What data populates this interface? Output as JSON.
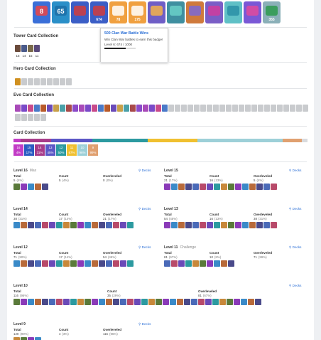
{
  "badges": [
    {
      "id": "b1",
      "top": "8",
      "bottom": "",
      "color": "#3a6fd8",
      "accent": "#e44"
    },
    {
      "id": "b2",
      "top": "65",
      "bottom": "",
      "color": "#2a8fc8",
      "accent": "#1c6fa6"
    },
    {
      "id": "b3",
      "top": "",
      "bottom": "",
      "color": "#3b5ec6",
      "accent": "#d23c3c"
    },
    {
      "id": "b4",
      "top": "",
      "bottom": "674",
      "color": "#3b5ec6",
      "accent": "#d23c3c"
    },
    {
      "id": "b5",
      "top": "",
      "bottom": "78",
      "color": "#f0a040",
      "accent": "#ffffff"
    },
    {
      "id": "b6",
      "top": "",
      "bottom": "175",
      "color": "#f0a040",
      "accent": "#ffffff"
    },
    {
      "id": "b7",
      "top": "",
      "bottom": "",
      "color": "#6f5ec6",
      "accent": "#f3b24a"
    },
    {
      "id": "b8",
      "top": "",
      "bottom": "",
      "color": "#3f8fa0",
      "accent": "#6ad0c8"
    },
    {
      "id": "b9",
      "top": "",
      "bottom": "",
      "color": "#cf7a3c",
      "accent": "#7a68d6"
    },
    {
      "id": "b10",
      "top": "",
      "bottom": "",
      "color": "#7a5ec6",
      "accent": "#d03c9c"
    },
    {
      "id": "b11",
      "top": "",
      "bottom": "",
      "color": "#5fc0c6",
      "accent": "#2a8fa6"
    },
    {
      "id": "b12",
      "top": "",
      "bottom": "",
      "color": "#7a58d6",
      "accent": "#e04a9c"
    },
    {
      "id": "b13",
      "top": "",
      "bottom": "355",
      "color": "#8bb0b8",
      "accent": "#2d9a4c"
    }
  ],
  "tooltip": {
    "title": "500 Clan War Battle Wins",
    "desc": "Win Clan War battles to earn this badge!",
    "level": "Level 6: 674 / 1000",
    "progress": 0.674
  },
  "sections": {
    "tower": "Tower Card Collection",
    "hero": "Hero Card Collection",
    "evo": "Evo Card Collection",
    "card": "Card Collection"
  },
  "tower_counts": [
    "15",
    "14",
    "15",
    "11"
  ],
  "card_collection": [
    {
      "label": "16",
      "pct": "4%",
      "color": "#c23cc6"
    },
    {
      "label": "15",
      "pct": "17%",
      "color": "#2b5cc2"
    },
    {
      "label": "14",
      "pct": "31%",
      "color": "#a83c8a"
    },
    {
      "label": "13",
      "pct": "45%",
      "color": "#5b57c6"
    },
    {
      "label": "12",
      "pct": "50%",
      "color": "#2c9aa0"
    },
    {
      "label": "11",
      "pct": "67%",
      "color": "#f0c030"
    },
    {
      "label": "10",
      "pct": "96%",
      "color": "#9dd0d8"
    },
    {
      "label": "9",
      "pct": "99%",
      "color": "#e0a070"
    }
  ],
  "levels": {
    "l16": {
      "name": "Level 16",
      "sub": "Max",
      "total": "5",
      "total_pct": "(4%)",
      "count": "5",
      "count_pct": "(4%)",
      "over": "0",
      "over_pct": "(0%)"
    },
    "l15": {
      "name": "Level 15",
      "sub": "",
      "total": "21",
      "total_pct": "(17%)",
      "count": "16",
      "count_pct": "(13%)",
      "over": "5",
      "over_pct": "(4%)"
    },
    "l14": {
      "name": "Level 14",
      "sub": "",
      "total": "38",
      "total_pct": "(31%)",
      "count": "17",
      "count_pct": "(14%)",
      "over": "21",
      "over_pct": "(17%)"
    },
    "l13": {
      "name": "Level 13",
      "sub": "",
      "total": "54",
      "total_pct": "(45%)",
      "count": "16",
      "count_pct": "(13%)",
      "over": "38",
      "over_pct": "(31%)"
    },
    "l12": {
      "name": "Level 12",
      "sub": "",
      "total": "71",
      "total_pct": "(50%)",
      "count": "17",
      "count_pct": "(14%)",
      "over": "54",
      "over_pct": "(45%)"
    },
    "l11": {
      "name": "Level 11",
      "sub": "Challenge",
      "total": "81",
      "total_pct": "(67%)",
      "count": "10",
      "count_pct": "(8%)",
      "over": "71",
      "over_pct": "(59%)"
    },
    "l10": {
      "name": "Level 10",
      "sub": "",
      "total": "116",
      "total_pct": "(96%)",
      "count": "35",
      "count_pct": "(29%)",
      "over": "81",
      "over_pct": "(67%)"
    },
    "l9": {
      "name": "Level 9",
      "sub": "",
      "total": "120",
      "total_pct": "(99%)",
      "count": "4",
      "count_pct": "(3%)",
      "over": "116",
      "over_pct": "(96%)"
    }
  },
  "labels": {
    "total": "Total",
    "count": "Count",
    "over": "Overleveled",
    "decks": "Decks"
  }
}
